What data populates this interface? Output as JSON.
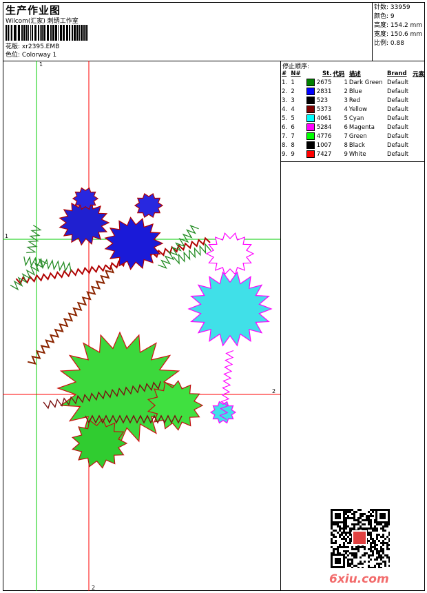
{
  "header": {
    "title": "生产作业图",
    "company": "Wilcom(汇家) 刺绣工作室",
    "design_label": "花版: xr2395.EMB",
    "colorway_label": "色位: Colorway 1"
  },
  "stats": [
    {
      "label": "针数",
      "value": "33959"
    },
    {
      "label": "颜色",
      "value": "9"
    },
    {
      "label": "高度",
      "value": "154.2 mm"
    },
    {
      "label": "宽度",
      "value": "150.6 mm"
    },
    {
      "label": "比例",
      "value": "0.88"
    }
  ],
  "stop_sequence": {
    "title": "停止顺序:",
    "headers": [
      "#",
      "N#",
      "St.",
      "代码",
      "描述",
      "Brand",
      "元素"
    ],
    "rows": [
      {
        "idx": "1.",
        "n": "1",
        "color": "#008000",
        "st": "2675",
        "code": "1",
        "desc": "Dark Green",
        "brand": "Default"
      },
      {
        "idx": "2.",
        "n": "2",
        "color": "#0000ff",
        "st": "2831",
        "code": "2",
        "desc": "Blue",
        "brand": "Default"
      },
      {
        "idx": "3.",
        "n": "3",
        "color": "#000000",
        "st": "523",
        "code": "3",
        "desc": "Red",
        "brand": "Default"
      },
      {
        "idx": "4.",
        "n": "4",
        "color": "#800000",
        "st": "5373",
        "code": "4",
        "desc": "Yellow",
        "brand": "Default"
      },
      {
        "idx": "5.",
        "n": "5",
        "color": "#00ffff",
        "st": "4061",
        "code": "5",
        "desc": "Cyan",
        "brand": "Default"
      },
      {
        "idx": "6.",
        "n": "6",
        "color": "#ff00ff",
        "st": "5284",
        "code": "6",
        "desc": "Magenta",
        "brand": "Default"
      },
      {
        "idx": "7.",
        "n": "7",
        "color": "#00ff00",
        "st": "4776",
        "code": "7",
        "desc": "Green",
        "brand": "Default"
      },
      {
        "idx": "8.",
        "n": "8",
        "color": "#000000",
        "st": "1007",
        "code": "8",
        "desc": "Black",
        "brand": "Default"
      },
      {
        "idx": "9.",
        "n": "9",
        "color": "#ff0000",
        "st": "7427",
        "code": "9",
        "desc": "White",
        "brand": "Default"
      }
    ]
  },
  "axes": {
    "v1": "1",
    "h1": "1",
    "h2": "2",
    "v2": "2"
  },
  "colors": {
    "guide_green": "#00cc00",
    "guide_red": "#ff0000"
  },
  "watermark": "6xiu.com"
}
